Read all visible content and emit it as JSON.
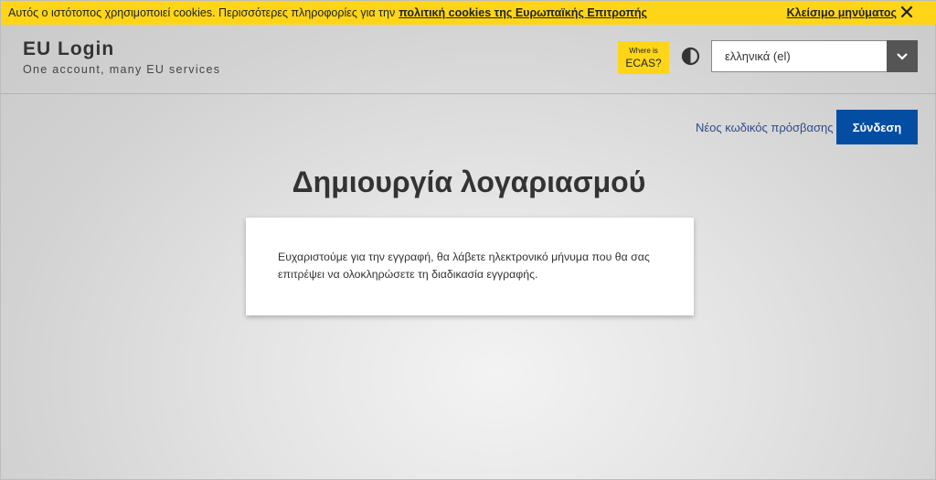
{
  "cookie_bar": {
    "message": "Αυτός ο ιστότοπος χρησιμοποιεί cookies. Περισσότερες πληροφορίες για την",
    "link_text": "πολιτική cookies της Ευρωπαϊκής Επιτροπής",
    "close_label": "Κλείσιμο μηνύματος",
    "close_glyph": "✕"
  },
  "header": {
    "title": "EU Login",
    "subtitle": "One account, many EU services",
    "ecas_small": "Where is",
    "ecas_big": "ECAS?",
    "language_selected": "ελληνικά (el)"
  },
  "actions": {
    "new_password": "Νέος κωδικός πρόσβασης",
    "login": "Σύνδεση"
  },
  "main": {
    "title": "Δημιουργία λογαριασμού",
    "message_line1": "Ευχαριστούμε για την εγγραφή, θα λάβετε ηλεκτρονικό μήνυμα που θα σας",
    "message_line2": "επιτρέψει να ολοκληρώσετε τη διαδικασία εγγραφής."
  },
  "colors": {
    "accent_yellow": "#ffd617",
    "button_blue": "#034ea2",
    "link_blue": "#2b4d8c"
  },
  "icons": {
    "contrast": "contrast-icon",
    "chevron": "chevron-down-icon",
    "close": "close-icon"
  }
}
